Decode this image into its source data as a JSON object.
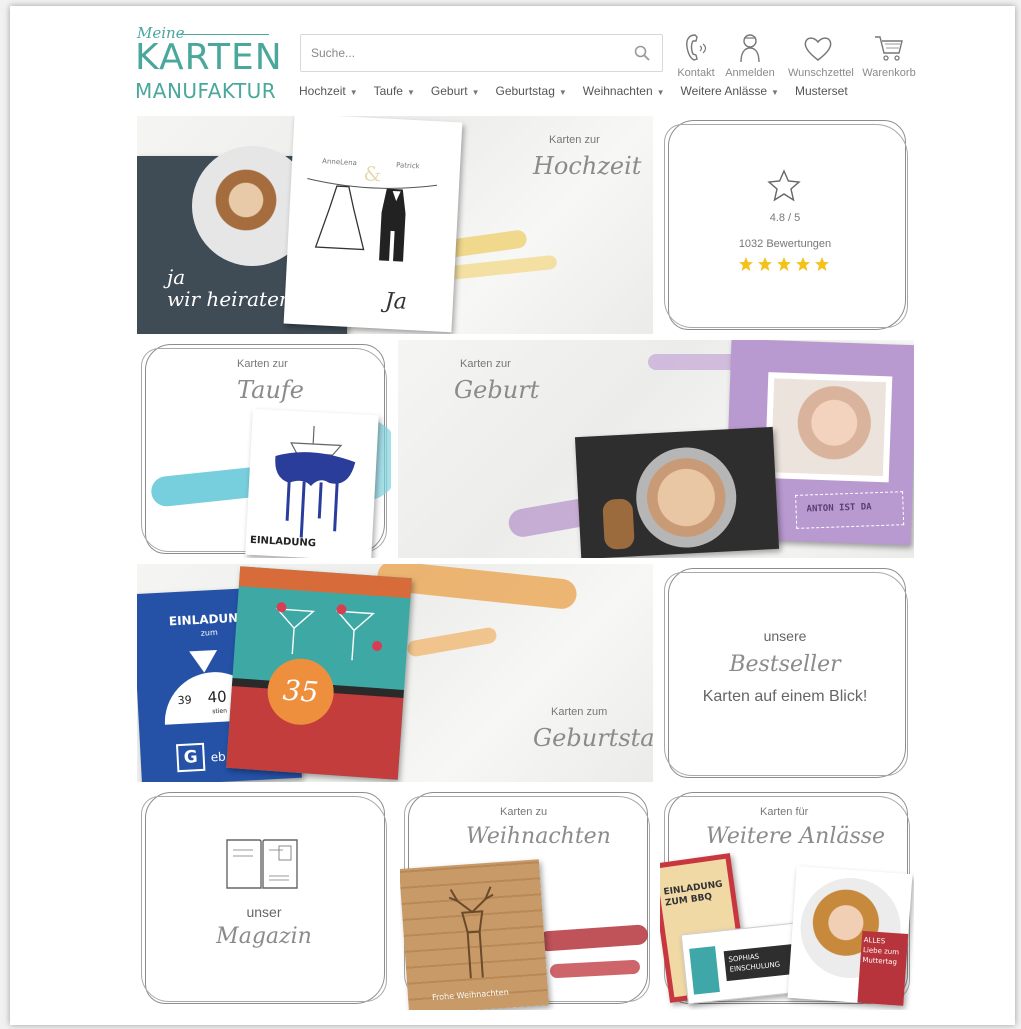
{
  "header": {
    "logo": {
      "meine": "Meine",
      "karten": "KARTEN",
      "manufaktur": "MANUFAKTUR"
    },
    "search": {
      "placeholder": "Suche..."
    },
    "icons": [
      {
        "name": "kontakt-icon",
        "label": "Kontakt"
      },
      {
        "name": "anmelden-icon",
        "label": "Anmelden"
      },
      {
        "name": "heart-icon",
        "label": "Wunschzettel"
      },
      {
        "name": "cart-icon",
        "label": "Warenkorb"
      }
    ],
    "nav": [
      {
        "label": "Hochzeit",
        "dropdown": true
      },
      {
        "label": "Taufe",
        "dropdown": true
      },
      {
        "label": "Geburt",
        "dropdown": true
      },
      {
        "label": "Geburtstag",
        "dropdown": true
      },
      {
        "label": "Weihnachten",
        "dropdown": true
      },
      {
        "label": "Weitere Anlässe",
        "dropdown": true
      },
      {
        "label": "Musterset",
        "dropdown": false
      }
    ]
  },
  "tiles": {
    "hochzeit": {
      "small": "Karten zur",
      "script": "Hochzeit",
      "card_left": "ja\nwir heiraten",
      "card_names_left": "AnneLena",
      "card_names_right": "Patrick",
      "card_amp": "&",
      "card_sig": "Ja"
    },
    "rating": {
      "score": "4.8 / 5",
      "count": "1032 Bewertungen",
      "stars": 5,
      "star_color": "#f4c21b"
    },
    "taufe": {
      "small": "Karten zur",
      "script": "Taufe",
      "card": "EINLADUNG"
    },
    "geburt": {
      "small": "Karten zur",
      "script": "Geburt",
      "card": "ANTON IST DA"
    },
    "geburtstag": {
      "small": "Karten zum",
      "script": "Geburtstag",
      "card_blue_title": "EINLADUNG",
      "card_blue_sub": "zum",
      "dial_left": "39",
      "dial_mid": "40",
      "dial_sub": "stien",
      "badge_letter": "G",
      "badge_tail": "eb",
      "card_number": "35"
    },
    "bestseller": {
      "small": "unsere",
      "script": "Bestseller",
      "text": "Karten auf einem Blick!"
    },
    "magazin": {
      "small": "unser",
      "script": "Magazin"
    },
    "weihnachten": {
      "small": "Karten zu",
      "script": "Weihnachten",
      "card": "Frohe Weihnachten"
    },
    "weitere": {
      "small": "Karten für",
      "script": "Weitere Anlässe",
      "card1": "EINLADUNG ZUM BBQ",
      "card2": "SOPHIAS EINSCHULUNG",
      "card3": "ALLES Liebe zum Muttertag"
    }
  },
  "colors": {
    "brand": "#4aa79c"
  }
}
